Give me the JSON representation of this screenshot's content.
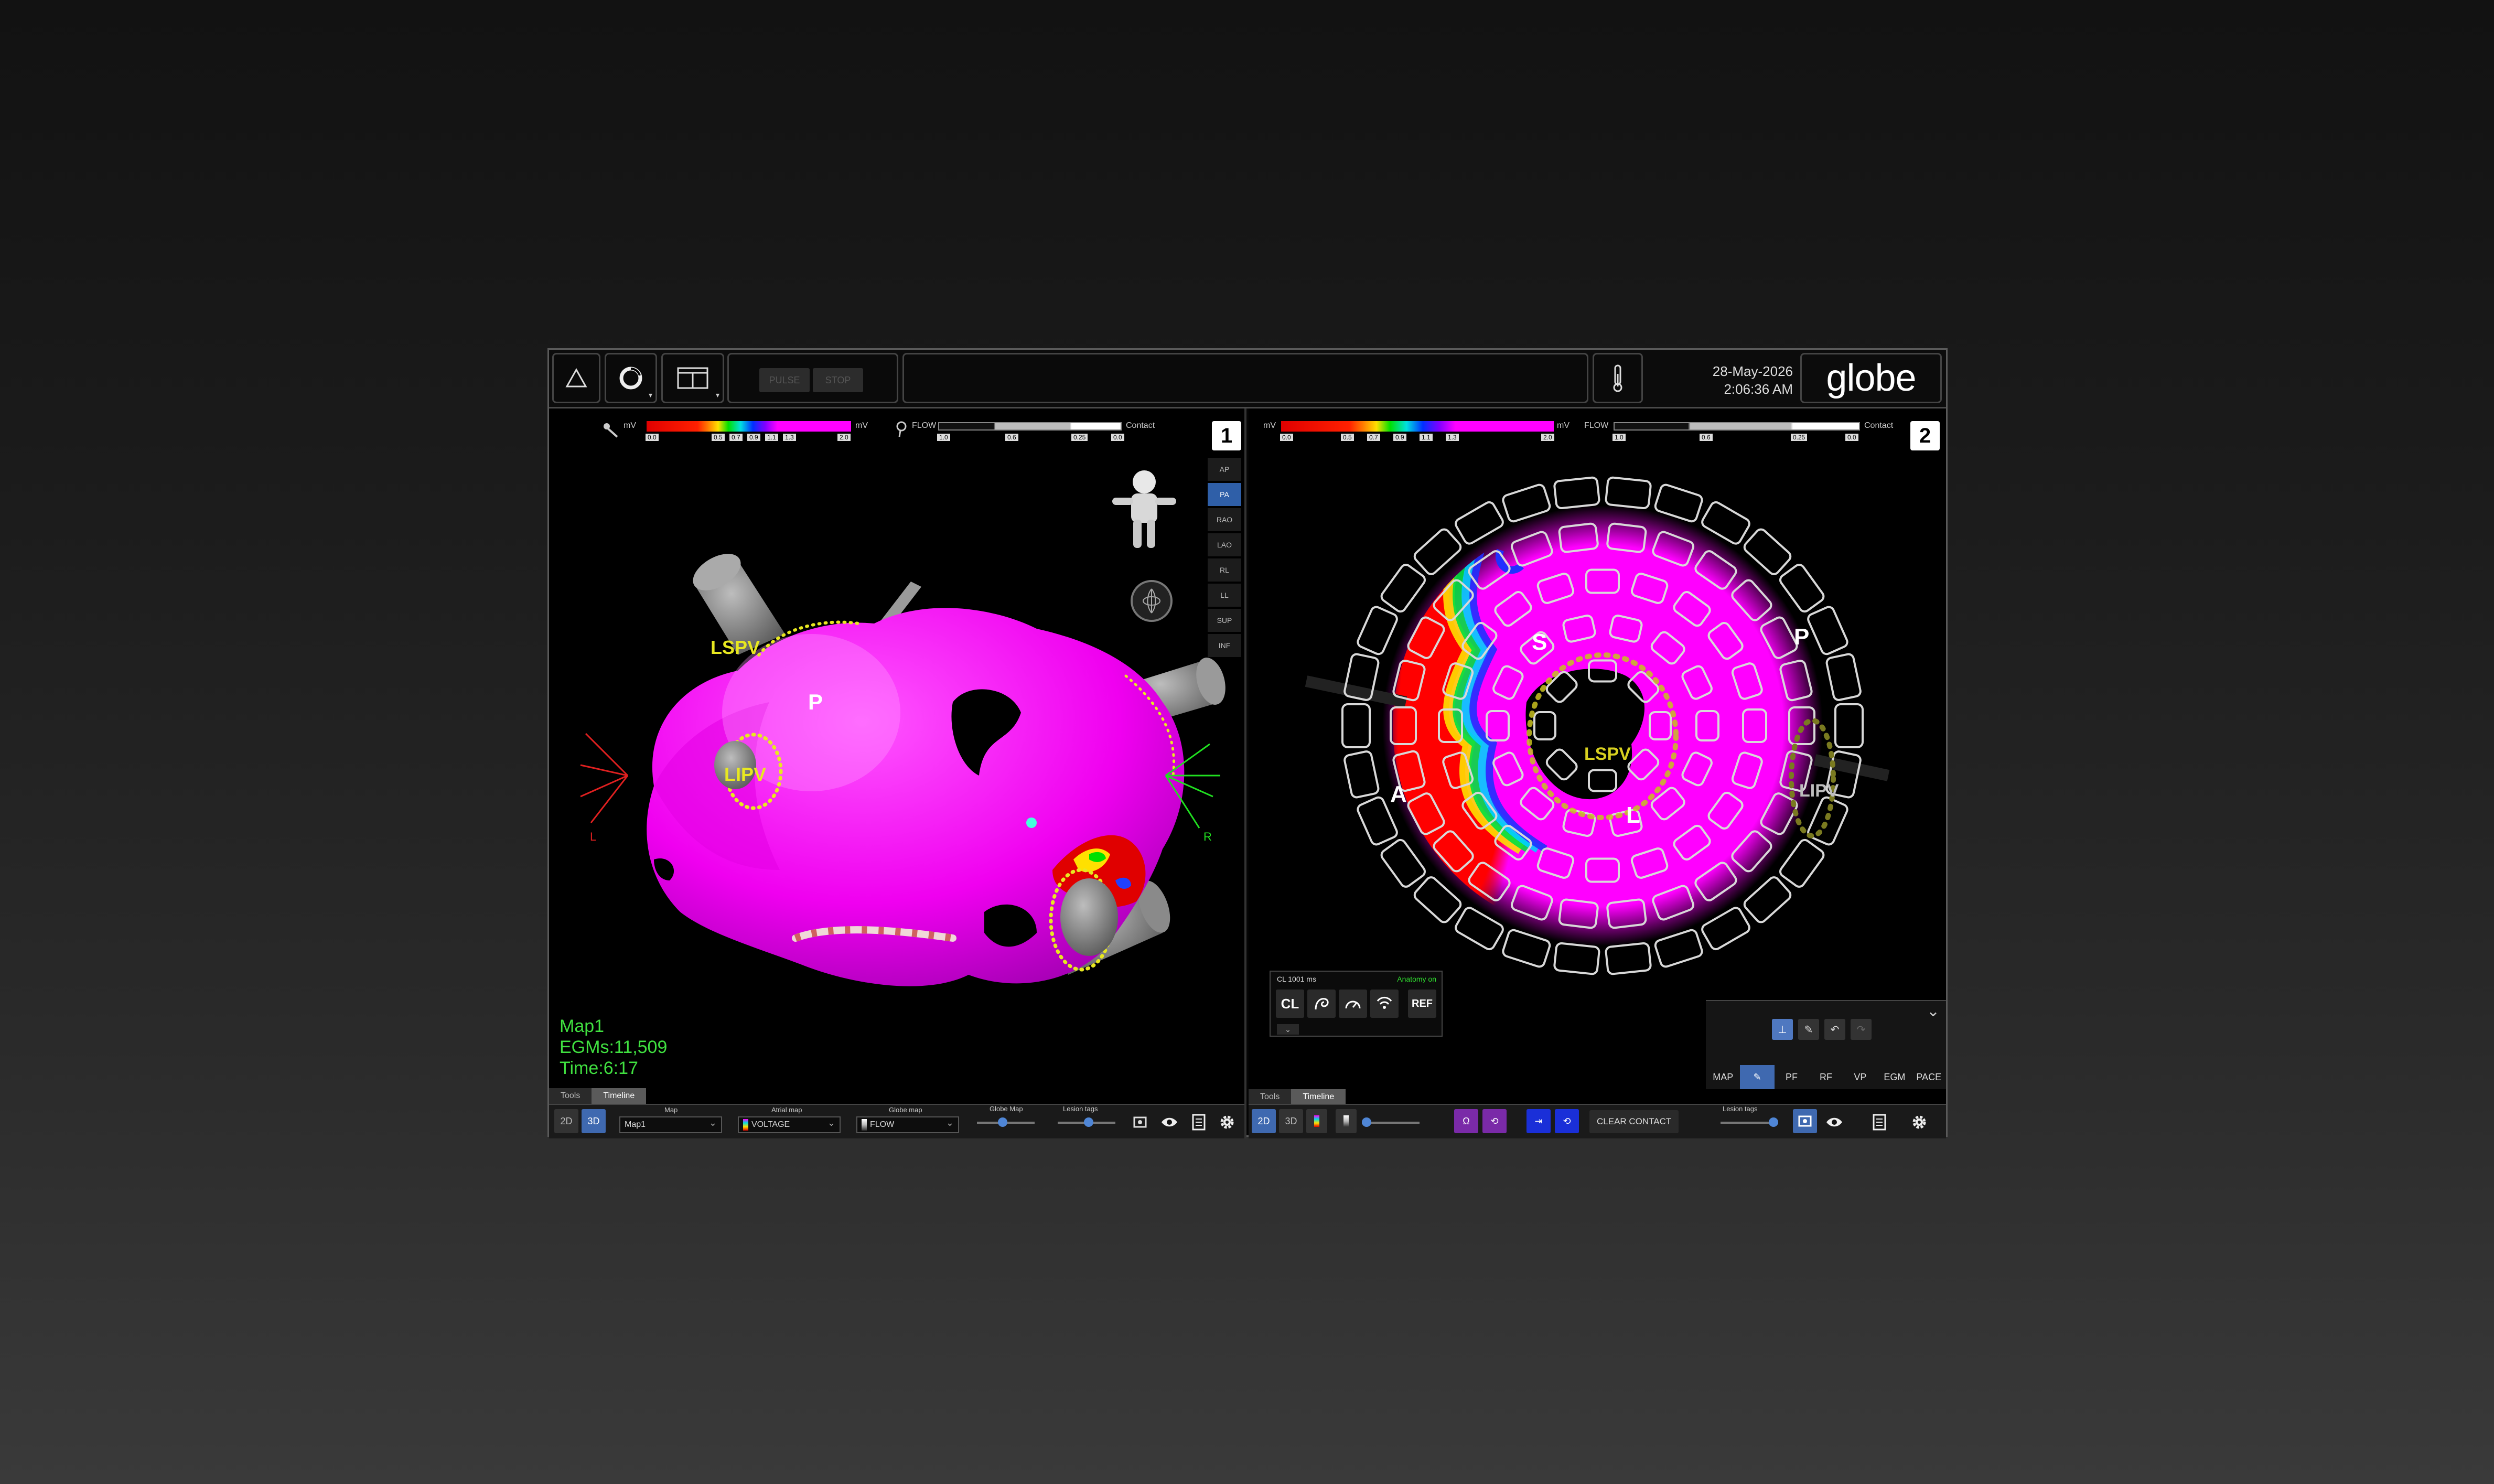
{
  "topbar": {
    "pulse_label": "PULSE",
    "stop_label": "STOP",
    "date": "28-May-2026",
    "time": "2:06:36 AM",
    "logo": "globe"
  },
  "legend": {
    "mv_label": "mV",
    "mv_ticks": [
      "0.0",
      "0.5",
      "0.7",
      "0.9",
      "1.1",
      "1.3",
      "2.0"
    ],
    "flow_label": "FLOW",
    "flow_ticks": [
      "1.0",
      "0.6",
      "0.25",
      "0.0"
    ],
    "contact_label": "Contact"
  },
  "panel1": {
    "number": "1",
    "views": [
      "AP",
      "PA",
      "RAO",
      "LAO",
      "RL",
      "LL",
      "SUP",
      "INF"
    ],
    "active_view": "PA",
    "labels": {
      "lspv": "LSPV",
      "lipv": "LIPV",
      "p": "P",
      "l": "L",
      "r": "R"
    },
    "info": {
      "map": "Map1",
      "egms": "EGMs:11,509",
      "time": "Time:6:17"
    },
    "tabs": [
      "Tools",
      "Timeline"
    ],
    "controls": {
      "btn_2d": "2D",
      "btn_3d": "3D",
      "map_label": "Map",
      "map_value": "Map1",
      "atrial_label": "Atrial map",
      "atrial_value": "VOLTAGE",
      "globe_label": "Globe map",
      "globe_value": "FLOW",
      "globe_map_slider_label": "Globe Map",
      "lesion_label": "Lesion tags"
    }
  },
  "panel2": {
    "number": "2",
    "labels": {
      "s": "S",
      "p": "P",
      "a": "A",
      "l": "L",
      "lspv": "LSPV",
      "lipv": "LIPV"
    },
    "cl_panel": {
      "cl_value": "CL 1001 ms",
      "anatomy": "Anatomy on",
      "cl_btn": "CL",
      "ref_btn": "REF"
    },
    "tool_tabs": [
      "MAP",
      "PF",
      "RF",
      "VP",
      "EGM",
      "PACE"
    ],
    "tabs": [
      "Tools",
      "Timeline"
    ],
    "controls": {
      "btn_2d": "2D",
      "btn_3d": "3D",
      "clear_contact": "CLEAR CONTACT",
      "lesion_label": "Lesion tags"
    }
  },
  "colors": {
    "voltage_high": "#ff00ff",
    "voltage_low": "#e00000",
    "accent_blue": "#3f69b0",
    "info_green": "#40e040",
    "pv_ring_yellow": "#e8e820"
  }
}
